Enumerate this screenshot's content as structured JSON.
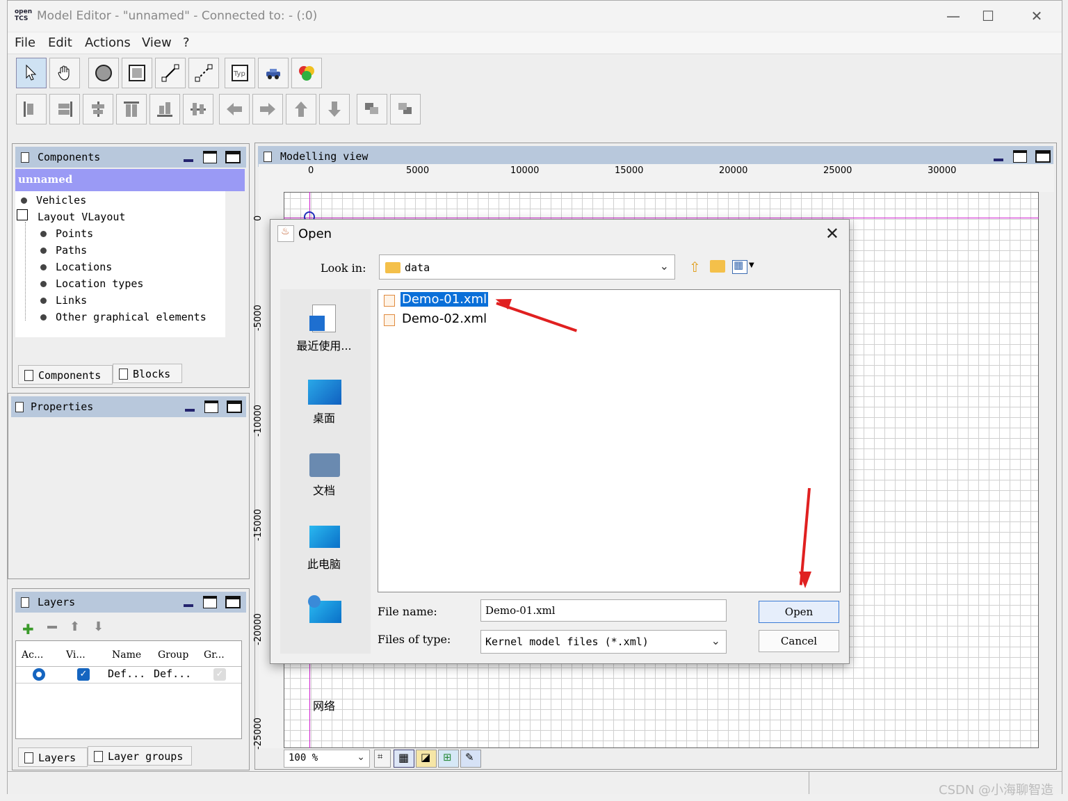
{
  "window": {
    "logo": "open\nTCS",
    "title": "Model Editor - \"unnamed\" - Connected to: - (:0)",
    "minimize": "—",
    "maximize": "☐",
    "close": "✕"
  },
  "menu": [
    "File",
    "Edit",
    "Actions",
    "View",
    "?"
  ],
  "components_panel": {
    "title": "Components",
    "root": "unnamed",
    "items": [
      "Vehicles",
      "Layout VLayout",
      "Points",
      "Paths",
      "Locations",
      "Location types",
      "Links",
      "Other graphical elements"
    ],
    "tabs": [
      "Components",
      "Blocks"
    ]
  },
  "properties_panel": {
    "title": "Properties"
  },
  "layers_panel": {
    "title": "Layers",
    "columns": [
      "Ac...",
      "Vi...",
      "Name",
      "Group",
      "Gr..."
    ],
    "row": {
      "name": "Def...",
      "group": "Def..."
    },
    "tabs": [
      "Layers",
      "Layer groups"
    ]
  },
  "modelling_view": {
    "title": "Modelling view",
    "x_ticks": [
      "0",
      "5000",
      "10000",
      "15000",
      "20000",
      "25000",
      "30000"
    ],
    "y_ticks": [
      "0",
      "-5000",
      "-10000",
      "-15000",
      "-20000",
      "-25000"
    ],
    "zoom": "100 %"
  },
  "open_dialog": {
    "title": "Open",
    "look_in_label": "Look in:",
    "look_in_value": "data",
    "places": [
      "最近使用...",
      "桌面",
      "文档",
      "此电脑",
      "网络"
    ],
    "files": [
      "Demo-01.xml",
      "Demo-02.xml"
    ],
    "selected_file": "Demo-01.xml",
    "file_name_label": "File name:",
    "file_name_value": "Demo-01.xml",
    "files_of_type_label": "Files of type:",
    "files_of_type_value": "Kernel model files (*.xml)",
    "open_button": "Open",
    "cancel_button": "Cancel"
  },
  "watermark": "CSDN @小海聊智造",
  "colors": {
    "selection": "#0a6fd8",
    "panel_header": "#b8c8dc",
    "root_highlight": "#9a9af5",
    "annotation_arrow": "#e02020"
  }
}
